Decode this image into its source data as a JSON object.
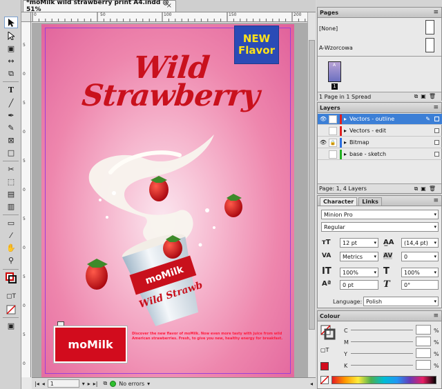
{
  "document": {
    "tab_title": "*moMilk wild strawberry print A4.indd @ 51%",
    "close_glyph": "×"
  },
  "rulers": {
    "h_labels": [
      "0",
      "50",
      "100",
      "150",
      "200"
    ],
    "v_labels": [
      "5",
      "0",
      "5",
      "0",
      "5",
      "0",
      "5",
      "0",
      "5",
      "0",
      "5",
      "0"
    ]
  },
  "artwork": {
    "badge_line1": "NEW",
    "badge_line2": "Flavor",
    "title_line1": "Wild",
    "title_line2": "Strawberry",
    "cup_brand": "moMilk",
    "cup_text": "Wild Strawb",
    "logo_text": "moMilk",
    "tagline": "Discover the new flavor of moMilk. Now even more tasty with juice from wild American strawberries. Fresh, to give you new, healthy energy for breakfast."
  },
  "status_bar": {
    "page_number": "1",
    "preflight_status": "No errors"
  },
  "pages_panel": {
    "title": "Pages",
    "master_none": "[None]",
    "master_a": "A-Wzorcowa",
    "page_thumb_label": "A",
    "page_number": "1",
    "footer": "1 Page in 1 Spread"
  },
  "layers_panel": {
    "title": "Layers",
    "layers": [
      {
        "name": "Vectors - outline",
        "color": "#e02020",
        "visible": true,
        "locked": false,
        "selected": true
      },
      {
        "name": "Vectors - edit",
        "color": "#e02020",
        "visible": false,
        "locked": false,
        "selected": false
      },
      {
        "name": "Bitmap",
        "color": "#2a6ee0",
        "visible": true,
        "locked": true,
        "selected": false
      },
      {
        "name": "base - sketch",
        "color": "#22b022",
        "visible": false,
        "locked": false,
        "selected": false
      }
    ],
    "footer": "Page: 1, 4 Layers"
  },
  "character_panel": {
    "tab_active": "Character",
    "tab_inactive": "Links",
    "font_family": "Minion Pro",
    "font_style": "Regular",
    "font_size": "12 pt",
    "leading": "(14,4 pt)",
    "kerning": "Metrics",
    "tracking": "0",
    "vertical_scale": "100%",
    "horizontal_scale": "100%",
    "baseline_shift": "0 pt",
    "skew": "0°",
    "language_label": "Language:",
    "language": "Polish"
  },
  "colour_panel": {
    "title": "Colour",
    "channels": [
      {
        "label": "C",
        "unit": "%"
      },
      {
        "label": "M",
        "unit": "%"
      },
      {
        "label": "Y",
        "unit": "%"
      },
      {
        "label": "K",
        "unit": "%"
      }
    ],
    "fill_color": "#d20c1d"
  },
  "colors": {
    "accent_blue": "#3c7fd6",
    "brand_red": "#c9111d",
    "page_pink": "#ee86ad"
  }
}
